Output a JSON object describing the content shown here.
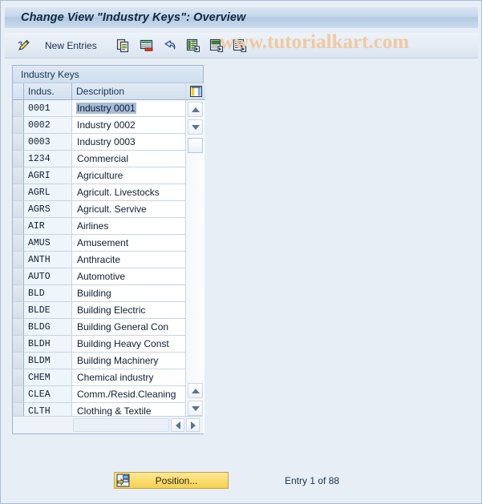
{
  "window": {
    "title": "Change View \"Industry Keys\": Overview"
  },
  "toolbar": {
    "edit_icon": "pencil-icon",
    "new_entries_label": "New Entries",
    "buttons": [
      {
        "name": "copy-as-button",
        "icon": "copy-icon"
      },
      {
        "name": "delete-button",
        "icon": "delete-row-icon"
      },
      {
        "name": "undo-button",
        "icon": "undo-arrow-icon"
      },
      {
        "name": "select-all-button",
        "icon": "select-all-icon"
      },
      {
        "name": "deselect-all-button",
        "icon": "deselect-all-icon"
      },
      {
        "name": "details-button",
        "icon": "details-icon"
      }
    ]
  },
  "watermark": {
    "text": "www.tutorialkart.com",
    "color": "#f0c9a0"
  },
  "group": {
    "title": "Industry Keys"
  },
  "table": {
    "settings_icon": "table-settings-icon",
    "columns": [
      {
        "key": "select",
        "label": ""
      },
      {
        "key": "indus",
        "label": "Indus."
      },
      {
        "key": "description",
        "label": "Description"
      }
    ],
    "selected_row_index": 0,
    "rows": [
      {
        "indus": "0001",
        "description": "Industry 0001"
      },
      {
        "indus": "0002",
        "description": "Industry 0002"
      },
      {
        "indus": "0003",
        "description": "Industry 0003"
      },
      {
        "indus": "1234",
        "description": "Commercial"
      },
      {
        "indus": "AGRI",
        "description": "Agriculture"
      },
      {
        "indus": "AGRL",
        "description": "Agricult. Livestocks"
      },
      {
        "indus": "AGRS",
        "description": "Agricult. Servive"
      },
      {
        "indus": "AIR",
        "description": "Airlines"
      },
      {
        "indus": "AMUS",
        "description": "Amusement"
      },
      {
        "indus": "ANTH",
        "description": "Anthracite"
      },
      {
        "indus": "AUTO",
        "description": "Automotive"
      },
      {
        "indus": "BLD",
        "description": "Building"
      },
      {
        "indus": "BLDE",
        "description": "Building Electric"
      },
      {
        "indus": "BLDG",
        "description": "Building General Con"
      },
      {
        "indus": "BLDH",
        "description": "Building Heavy Const"
      },
      {
        "indus": "BLDM",
        "description": "Building Machinery"
      },
      {
        "indus": "CHEM",
        "description": "Chemical industry"
      },
      {
        "indus": "CLEA",
        "description": "Comm./Resid.Cleaning"
      },
      {
        "indus": "CLTH",
        "description": "Clothing & Textile"
      }
    ]
  },
  "footer": {
    "position_button_label": "Position...",
    "position_button_icon": "position-icon",
    "entry_status": "Entry 1 of 88"
  }
}
